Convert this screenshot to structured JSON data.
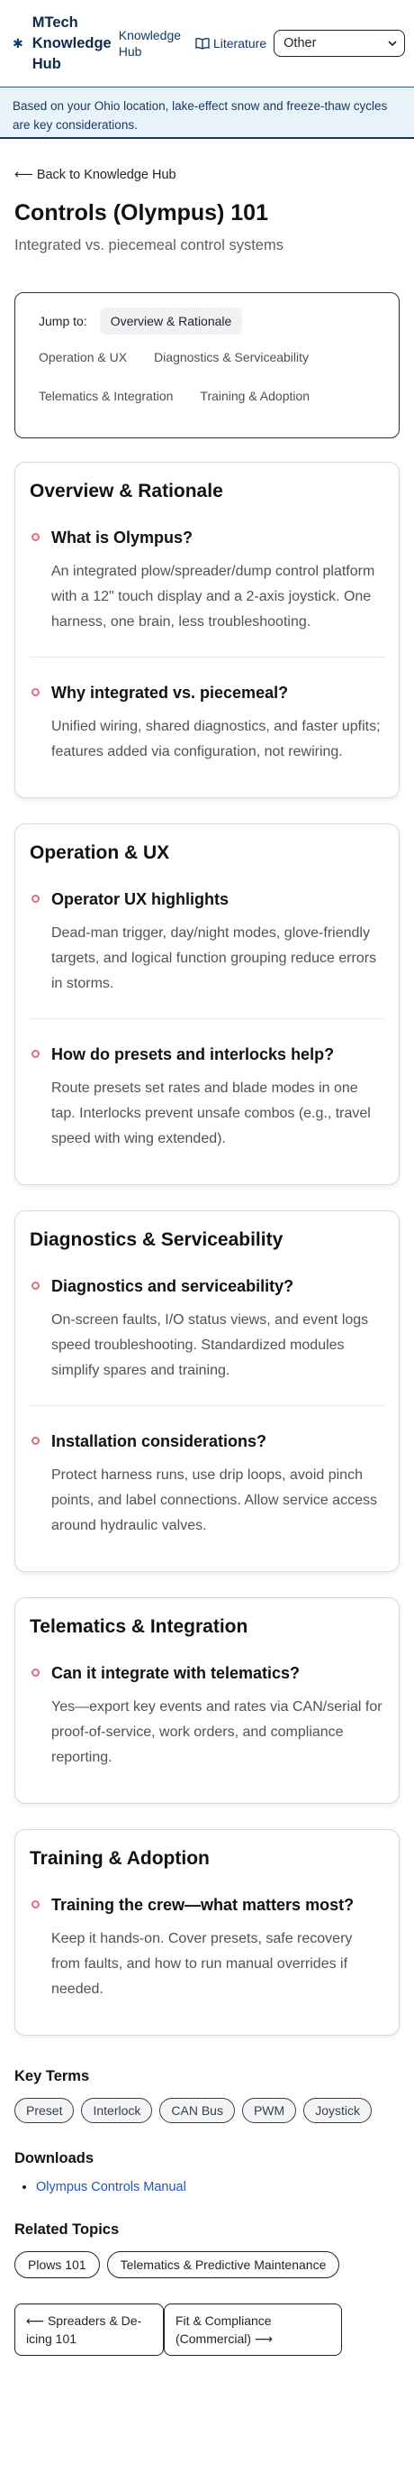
{
  "header": {
    "brand": "MTech Knowledge Hub",
    "nav_knowledge_hub": "Knowledge Hub",
    "nav_literature": "Literature",
    "region_select": "Other"
  },
  "banner": "Based on your Ohio location, lake-effect snow and freeze-thaw cycles are key considerations.",
  "back_link": "⟵ Back to Knowledge Hub",
  "title": "Controls (Olympus) 101",
  "subtitle": "Integrated vs. piecemeal control systems",
  "jump": {
    "label": "Jump to:",
    "items": [
      "Overview & Rationale",
      "Operation & UX",
      "Diagnostics & Serviceability",
      "Telematics & Integration",
      "Training & Adoption"
    ]
  },
  "sections": [
    {
      "title": "Overview & Rationale",
      "qa": [
        {
          "q": "What is Olympus?",
          "a": "An integrated plow/spreader/dump control platform with a 12\" touch display and a 2-axis joystick. One harness, one brain, less troubleshooting."
        },
        {
          "q": "Why integrated vs. piecemeal?",
          "a": "Unified wiring, shared diagnostics, and faster upfits; features added via configuration, not rewiring."
        }
      ]
    },
    {
      "title": "Operation & UX",
      "qa": [
        {
          "q": "Operator UX highlights",
          "a": "Dead-man trigger, day/night modes, glove-friendly targets, and logical function grouping reduce errors in storms."
        },
        {
          "q": "How do presets and interlocks help?",
          "a": "Route presets set rates and blade modes in one tap. Interlocks prevent unsafe combos (e.g., travel speed with wing extended)."
        }
      ]
    },
    {
      "title": "Diagnostics & Serviceability",
      "qa": [
        {
          "q": "Diagnostics and serviceability?",
          "a": "On-screen faults, I/O status views, and event logs speed troubleshooting. Standardized modules simplify spares and training."
        },
        {
          "q": "Installation considerations?",
          "a": "Protect harness runs, use drip loops, avoid pinch points, and label connections. Allow service access around hydraulic valves."
        }
      ]
    },
    {
      "title": "Telematics & Integration",
      "qa": [
        {
          "q": "Can it integrate with telematics?",
          "a": "Yes—export key events and rates via CAN/serial for proof-of-service, work orders, and compliance reporting."
        }
      ]
    },
    {
      "title": "Training & Adoption",
      "qa": [
        {
          "q": "Training the crew—what matters most?",
          "a": "Keep it hands-on. Cover presets, safe recovery from faults, and how to run manual overrides if needed."
        }
      ]
    }
  ],
  "key_terms": {
    "title": "Key Terms",
    "items": [
      "Preset",
      "Interlock",
      "CAN Bus",
      "PWM",
      "Joystick"
    ]
  },
  "downloads": {
    "title": "Downloads",
    "items": [
      "Olympus Controls Manual"
    ]
  },
  "related": {
    "title": "Related Topics",
    "items": [
      "Plows 101",
      "Telematics & Predictive Maintenance"
    ]
  },
  "pager": {
    "prev": "⟵ Spreaders & De-icing 101",
    "next": "Fit & Compliance (Commercial) ⟶"
  },
  "colors": {
    "brand_navy": "#123a66",
    "banner_bg": "#e9f3fb",
    "bullet_accent": "#e06d7a",
    "link_blue": "#1d55c6"
  }
}
